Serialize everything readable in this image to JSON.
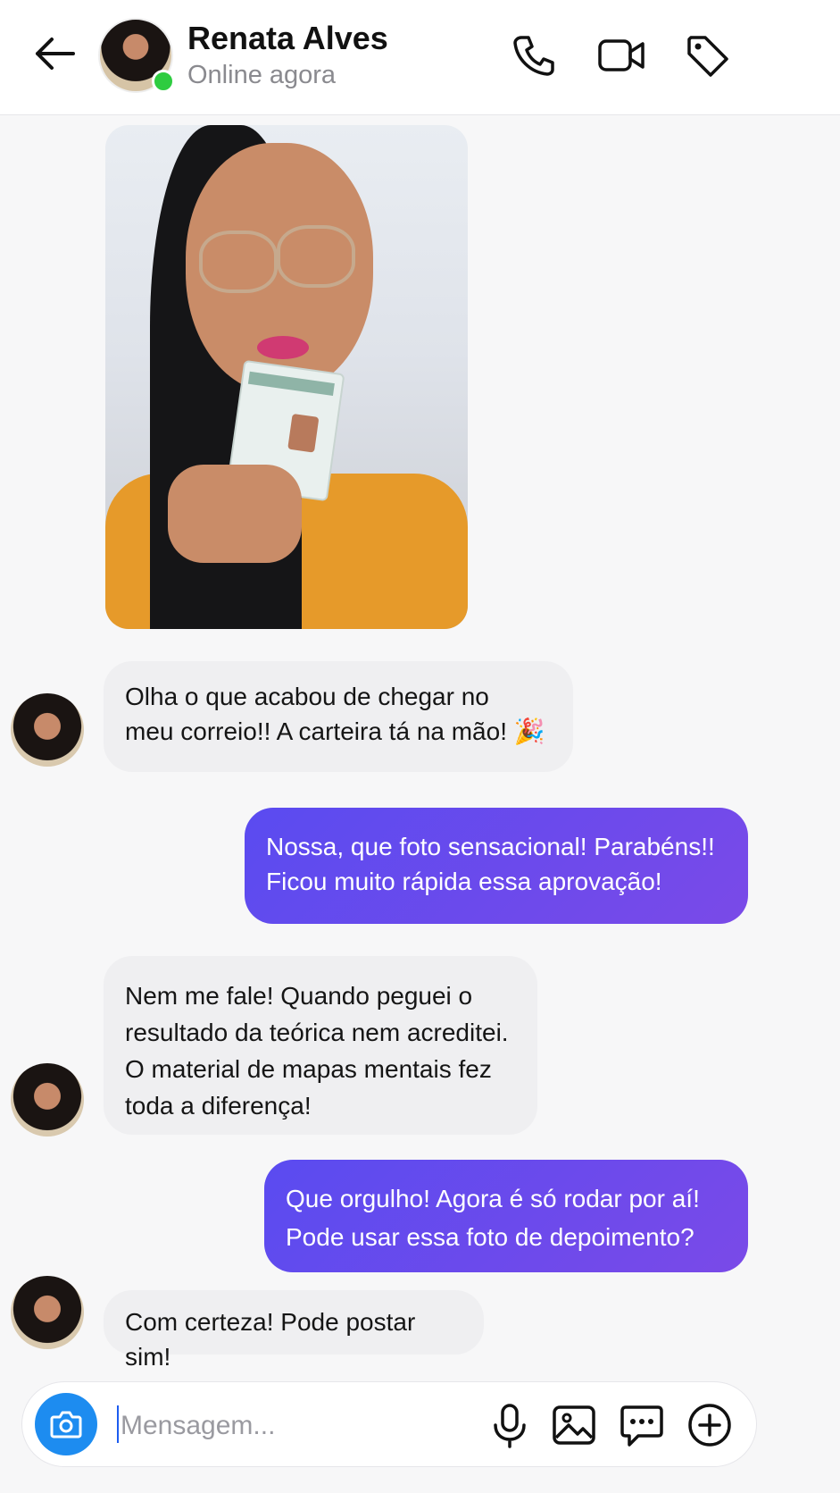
{
  "header": {
    "name": "Renata Alves",
    "status": "Online agora",
    "back_icon": "arrow-left-icon",
    "actions": [
      "phone-icon",
      "video-camera-icon",
      "tag-icon"
    ]
  },
  "messages": [
    {
      "side": "in",
      "type": "image",
      "description": ""
    },
    {
      "side": "in",
      "text": "Olha o que acabou de chegar no\nmeu correio!! A carteira tá na mão! 🎉"
    },
    {
      "side": "out",
      "text": "Nossa, que foto sensacional! Parabéns!!\nFicou muito rápida essa aprovação!"
    },
    {
      "side": "in",
      "text": "Nem me fale! Quando peguei o\nresultado da teórica nem acreditei.\nO material de mapas mentais fez\ntoda a diferença!"
    },
    {
      "side": "out",
      "text": "Que orgulho! Agora é só rodar por aí!\nPode usar essa foto de depoimento?"
    },
    {
      "side": "in",
      "text": "Com certeza! Pode postar sim!"
    }
  ],
  "composer": {
    "placeholder": "Mensagem...",
    "icons": [
      "camera-icon",
      "microphone-icon",
      "image-icon",
      "chat-bubble-icon",
      "plus-circle-icon"
    ]
  },
  "colors": {
    "outgoing_bubble": "#6a4bee",
    "incoming_bubble": "#efeff1",
    "online": "#2ecc40",
    "camera_button": "#1d8cf0"
  }
}
